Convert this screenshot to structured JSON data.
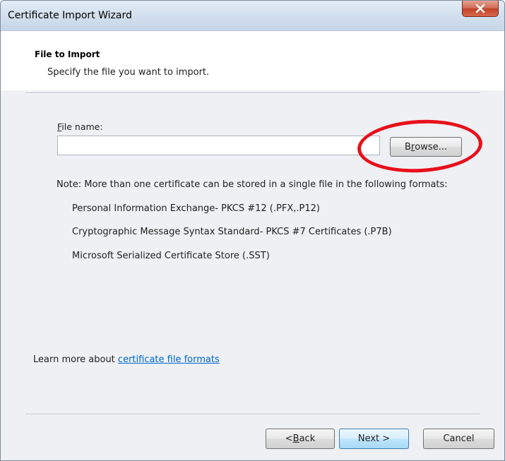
{
  "window": {
    "title": "Certificate Import Wizard",
    "close_glyph": "x"
  },
  "header": {
    "title": "File to Import",
    "subtitle": "Specify the file you want to import."
  },
  "file_field": {
    "label_accel": "F",
    "label_rest": "ile name:",
    "value": "",
    "placeholder": ""
  },
  "browse": {
    "accel": "r",
    "prefix": "B",
    "rest": "owse...",
    "annotation_color": "#e8101a"
  },
  "note": {
    "text": "Note:  More than one certificate can be stored in a single file in the following formats:",
    "formats": [
      "Personal Information Exchange- PKCS #12 (.PFX,.P12)",
      "Cryptographic Message Syntax Standard- PKCS #7 Certificates (.P7B)",
      "Microsoft Serialized Certificate Store (.SST)"
    ]
  },
  "learn_more": {
    "prefix": "Learn more about ",
    "link": "certificate file formats"
  },
  "footer": {
    "back_prefix": "< ",
    "back_accel": "B",
    "back_rest": "ack",
    "next": "Next >",
    "cancel": "Cancel"
  }
}
